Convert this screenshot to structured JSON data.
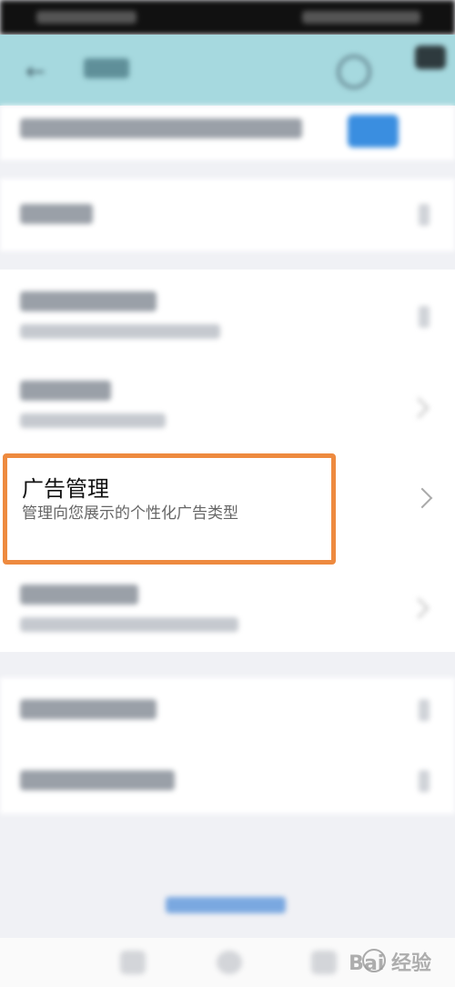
{
  "ad_management": {
    "title": "广告管理",
    "subtitle": "管理向您展示的个性化广告类型"
  },
  "watermark": {
    "text": "Bai 经验"
  },
  "colors": {
    "highlight": "#ee8a3f",
    "header": "#a6d9df",
    "accent_blue": "#3a8ee0"
  }
}
